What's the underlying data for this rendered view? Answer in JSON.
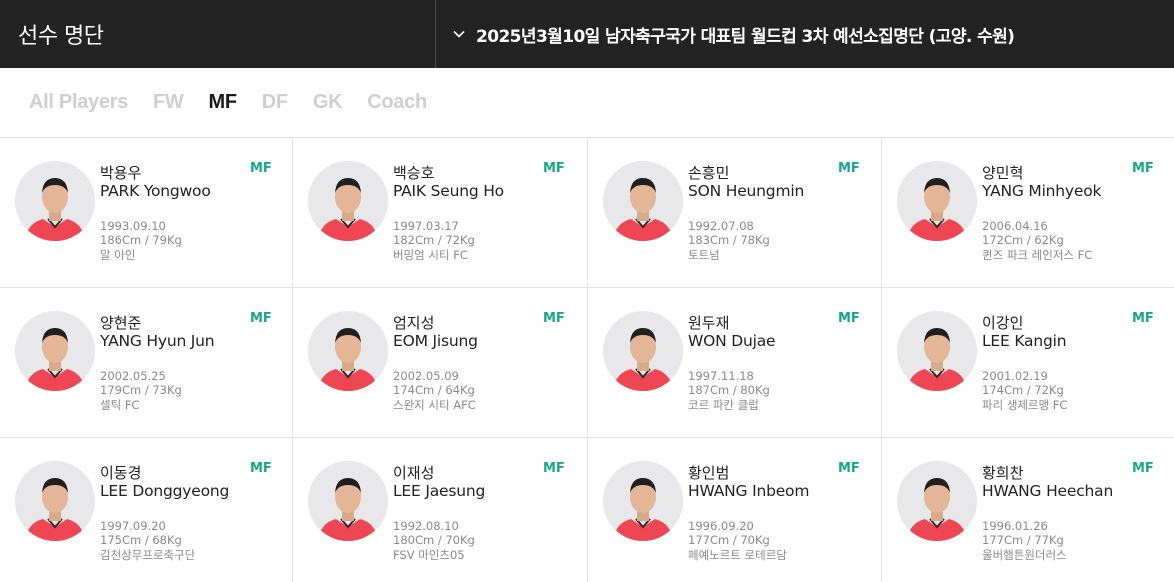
{
  "header": {
    "title": "선수 명단",
    "selector_label": "2025년3월10일 남자축구국가 대표팀 월드컵 3차 예선소집명단 (고양. 수원)"
  },
  "tabs": [
    {
      "label": "All Players",
      "active": false
    },
    {
      "label": "FW",
      "active": false
    },
    {
      "label": "MF",
      "active": true
    },
    {
      "label": "DF",
      "active": false
    },
    {
      "label": "GK",
      "active": false
    },
    {
      "label": "Coach",
      "active": false
    }
  ],
  "colors": {
    "position_accent": "#17a888",
    "jersey": "#ef4654",
    "header_bg": "#232323"
  },
  "players": [
    {
      "name_ko": "박용우",
      "name_en": "PARK Yongwoo",
      "position": "MF",
      "dob": "1993.09.10",
      "height_weight": "186Cm / 79Kg",
      "club": "알 아인"
    },
    {
      "name_ko": "백승호",
      "name_en": "PAIK Seung Ho",
      "position": "MF",
      "dob": "1997.03.17",
      "height_weight": "182Cm / 72Kg",
      "club": "버밍엄 시티 FC"
    },
    {
      "name_ko": "손흥민",
      "name_en": "SON Heungmin",
      "position": "MF",
      "dob": "1992.07.08",
      "height_weight": "183Cm / 78Kg",
      "club": "토트넘"
    },
    {
      "name_ko": "양민혁",
      "name_en": "YANG Minhyeok",
      "position": "MF",
      "dob": "2006.04.16",
      "height_weight": "172Cm / 62Kg",
      "club": "퀸즈 파크 레인저스 FC"
    },
    {
      "name_ko": "양현준",
      "name_en": "YANG Hyun Jun",
      "position": "MF",
      "dob": "2002.05.25",
      "height_weight": "179Cm / 73Kg",
      "club": "셀틱 FC"
    },
    {
      "name_ko": "엄지성",
      "name_en": "EOM Jisung",
      "position": "MF",
      "dob": "2002.05.09",
      "height_weight": "174Cm / 64Kg",
      "club": "스완지 시티 AFC"
    },
    {
      "name_ko": "원두재",
      "name_en": "WON Dujae",
      "position": "MF",
      "dob": "1997.11.18",
      "height_weight": "187Cm / 80Kg",
      "club": "코르 파칸 클럽"
    },
    {
      "name_ko": "이강인",
      "name_en": "LEE Kangin",
      "position": "MF",
      "dob": "2001.02.19",
      "height_weight": "174Cm / 72Kg",
      "club": "파리 생제르맹 FC"
    },
    {
      "name_ko": "이동경",
      "name_en": "LEE Donggyeong",
      "position": "MF",
      "dob": "1997.09.20",
      "height_weight": "175Cm / 68Kg",
      "club": "김천상무프로축구단"
    },
    {
      "name_ko": "이재성",
      "name_en": "LEE Jaesung",
      "position": "MF",
      "dob": "1992.08.10",
      "height_weight": "180Cm / 70Kg",
      "club": "FSV 마인츠05"
    },
    {
      "name_ko": "황인범",
      "name_en": "HWANG Inbeom",
      "position": "MF",
      "dob": "1996.09.20",
      "height_weight": "177Cm / 70Kg",
      "club": "페예노르트 로테르담"
    },
    {
      "name_ko": "황희찬",
      "name_en": "HWANG Heechan",
      "position": "MF",
      "dob": "1996.01.26",
      "height_weight": "177Cm / 77Kg",
      "club": "울버햄튼원더러스"
    }
  ]
}
